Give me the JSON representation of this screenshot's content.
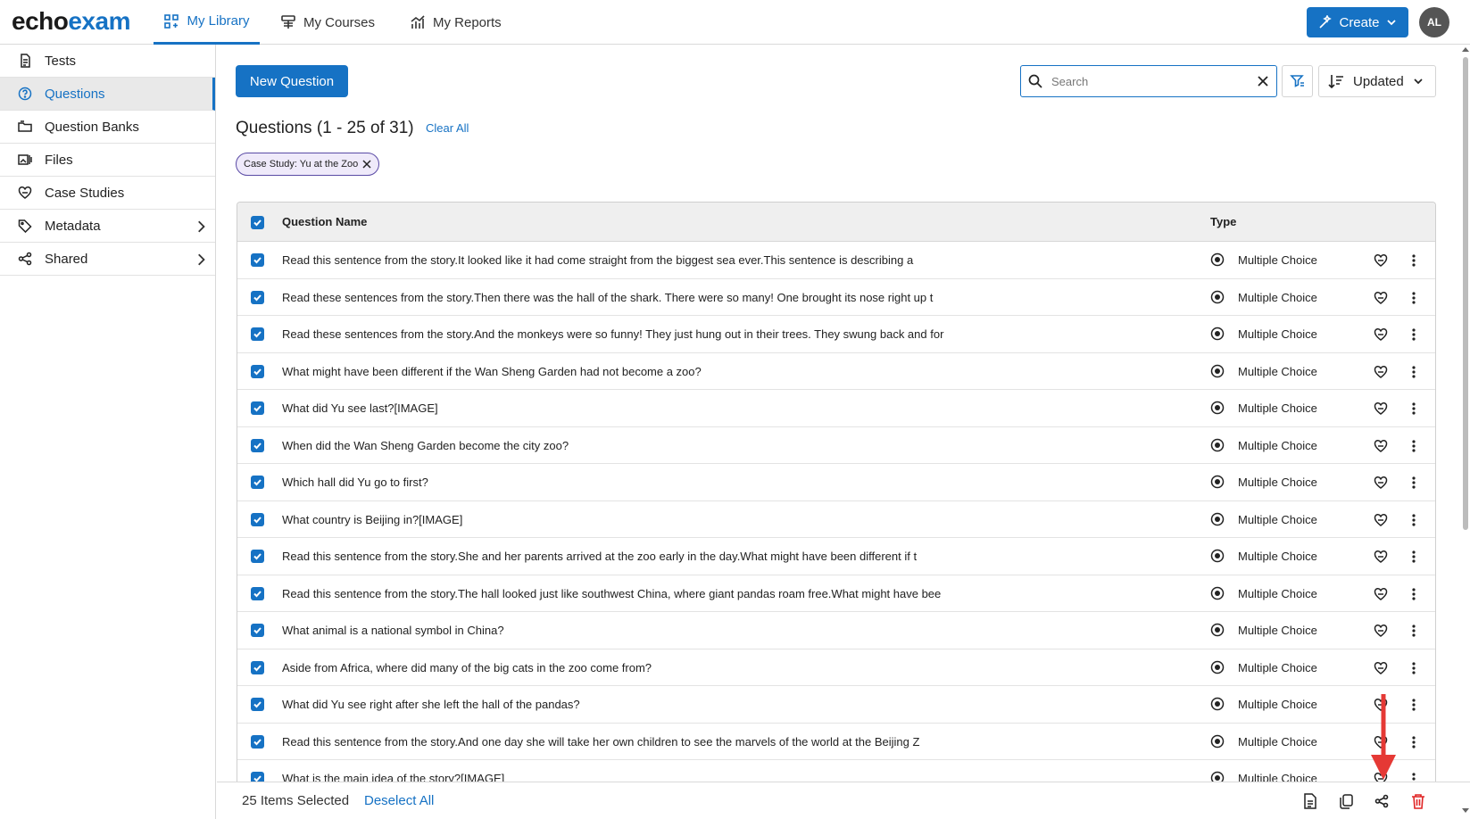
{
  "brand": {
    "logo_part1": "echo",
    "logo_part2": "exam"
  },
  "nav": {
    "tabs": [
      {
        "label": "My Library",
        "icon": "library-icon",
        "active": true
      },
      {
        "label": "My Courses",
        "icon": "courses-icon",
        "active": false
      },
      {
        "label": "My Reports",
        "icon": "reports-icon",
        "active": false
      }
    ],
    "create_label": "Create",
    "avatar_initials": "AL"
  },
  "sidebar": {
    "items": [
      {
        "label": "Tests",
        "icon": "document-icon"
      },
      {
        "label": "Questions",
        "icon": "question-icon",
        "active": true
      },
      {
        "label": "Question Banks",
        "icon": "folder-icon"
      },
      {
        "label": "Files",
        "icon": "files-icon"
      },
      {
        "label": "Case Studies",
        "icon": "heart-link-icon"
      },
      {
        "label": "Metadata",
        "icon": "tag-icon",
        "has_children": true
      },
      {
        "label": "Shared",
        "icon": "share-icon",
        "has_children": true
      }
    ]
  },
  "main": {
    "new_question_label": "New Question",
    "search_placeholder": "Search",
    "sort_label": "Updated",
    "heading": "Questions (1 - 25 of 31)",
    "clear_all": "Clear All",
    "filter_chip": "Case Study: Yu at the Zoo"
  },
  "table": {
    "columns": {
      "name": "Question Name",
      "type": "Type"
    },
    "rows": [
      {
        "name": "Read this sentence from the story.It looked like it had come straight from the biggest sea ever.This sentence is describing a",
        "type": "Multiple Choice"
      },
      {
        "name": "Read these sentences from the story.Then there was the hall of the shark. There were so many! One brought its nose right up t",
        "type": "Multiple Choice"
      },
      {
        "name": "Read these sentences from the story.And the monkeys were so funny! They just hung out in their trees. They swung back and for",
        "type": "Multiple Choice"
      },
      {
        "name": "What might have been different if the Wan Sheng Garden had not become a zoo?",
        "type": "Multiple Choice"
      },
      {
        "name": "What did Yu see last?[IMAGE]",
        "type": "Multiple Choice"
      },
      {
        "name": "When did the Wan Sheng Garden become the city zoo?",
        "type": "Multiple Choice"
      },
      {
        "name": "Which hall did Yu go to first?",
        "type": "Multiple Choice"
      },
      {
        "name": "What country is Beijing in?[IMAGE]",
        "type": "Multiple Choice"
      },
      {
        "name": "Read this sentence from the story.She and her parents arrived at the zoo early in the day.What might have been different if t",
        "type": "Multiple Choice"
      },
      {
        "name": "Read this sentence from the story.The hall looked just like southwest China, where giant pandas roam free.What might have bee",
        "type": "Multiple Choice"
      },
      {
        "name": "What animal is a national symbol in China?",
        "type": "Multiple Choice"
      },
      {
        "name": "Aside from Africa, where did many of the big cats in the zoo come from?",
        "type": "Multiple Choice"
      },
      {
        "name": "What did Yu see right after she left the hall of the pandas?",
        "type": "Multiple Choice"
      },
      {
        "name": "Read this sentence from the story.And one day she will take her own children to see the marvels of the world at the Beijing Z",
        "type": "Multiple Choice"
      },
      {
        "name": "What is the main idea of the story?[IMAGE]",
        "type": "Multiple Choice"
      }
    ]
  },
  "bottombar": {
    "selected_label": "25 Items Selected",
    "deselect_label": "Deselect All"
  },
  "colors": {
    "accent": "#1672c4",
    "danger": "#e02424",
    "annotation_arrow": "#e53935"
  }
}
